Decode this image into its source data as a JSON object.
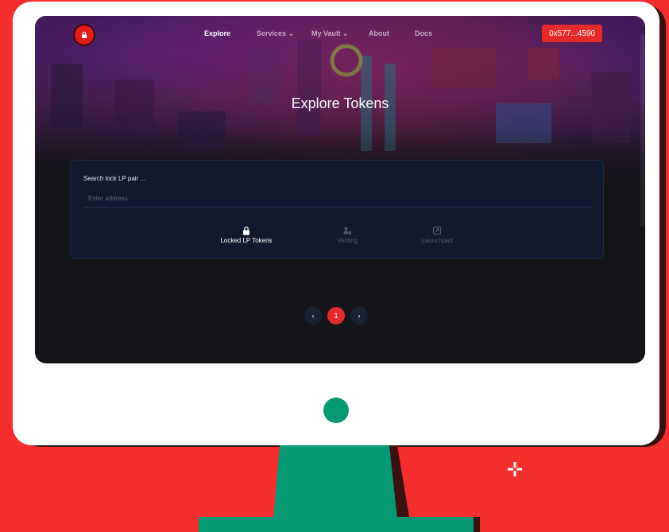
{
  "nav": {
    "links": [
      {
        "label": "Explore",
        "active": true
      },
      {
        "label": "Services",
        "dropdown": true
      },
      {
        "label": "My Vault",
        "dropdown": true
      },
      {
        "label": "About"
      },
      {
        "label": "Docs"
      }
    ],
    "wallet_label": "0x577...4590",
    "logo_icon": "lock-icon"
  },
  "hero": {
    "title": "Explore Tokens"
  },
  "search": {
    "label": "Search lock LP pair ...",
    "placeholder": "Enter address",
    "value": ""
  },
  "tabs": [
    {
      "label": "Locked LP Tokens",
      "icon": "lock-icon",
      "active": true
    },
    {
      "label": "Vesting",
      "icon": "users-icon",
      "active": false
    },
    {
      "label": "Launchpad",
      "icon": "rocket-icon",
      "active": false
    }
  ],
  "pagination": {
    "prev_icon": "chevron-left-icon",
    "current_page": "1",
    "next_icon": "chevron-right-icon"
  },
  "colors": {
    "accent": "#e52a2a",
    "background": "#f42d2d",
    "monitor_green": "#069873",
    "screen_bg": "#141518",
    "card_bg": "#0f1a2e"
  }
}
